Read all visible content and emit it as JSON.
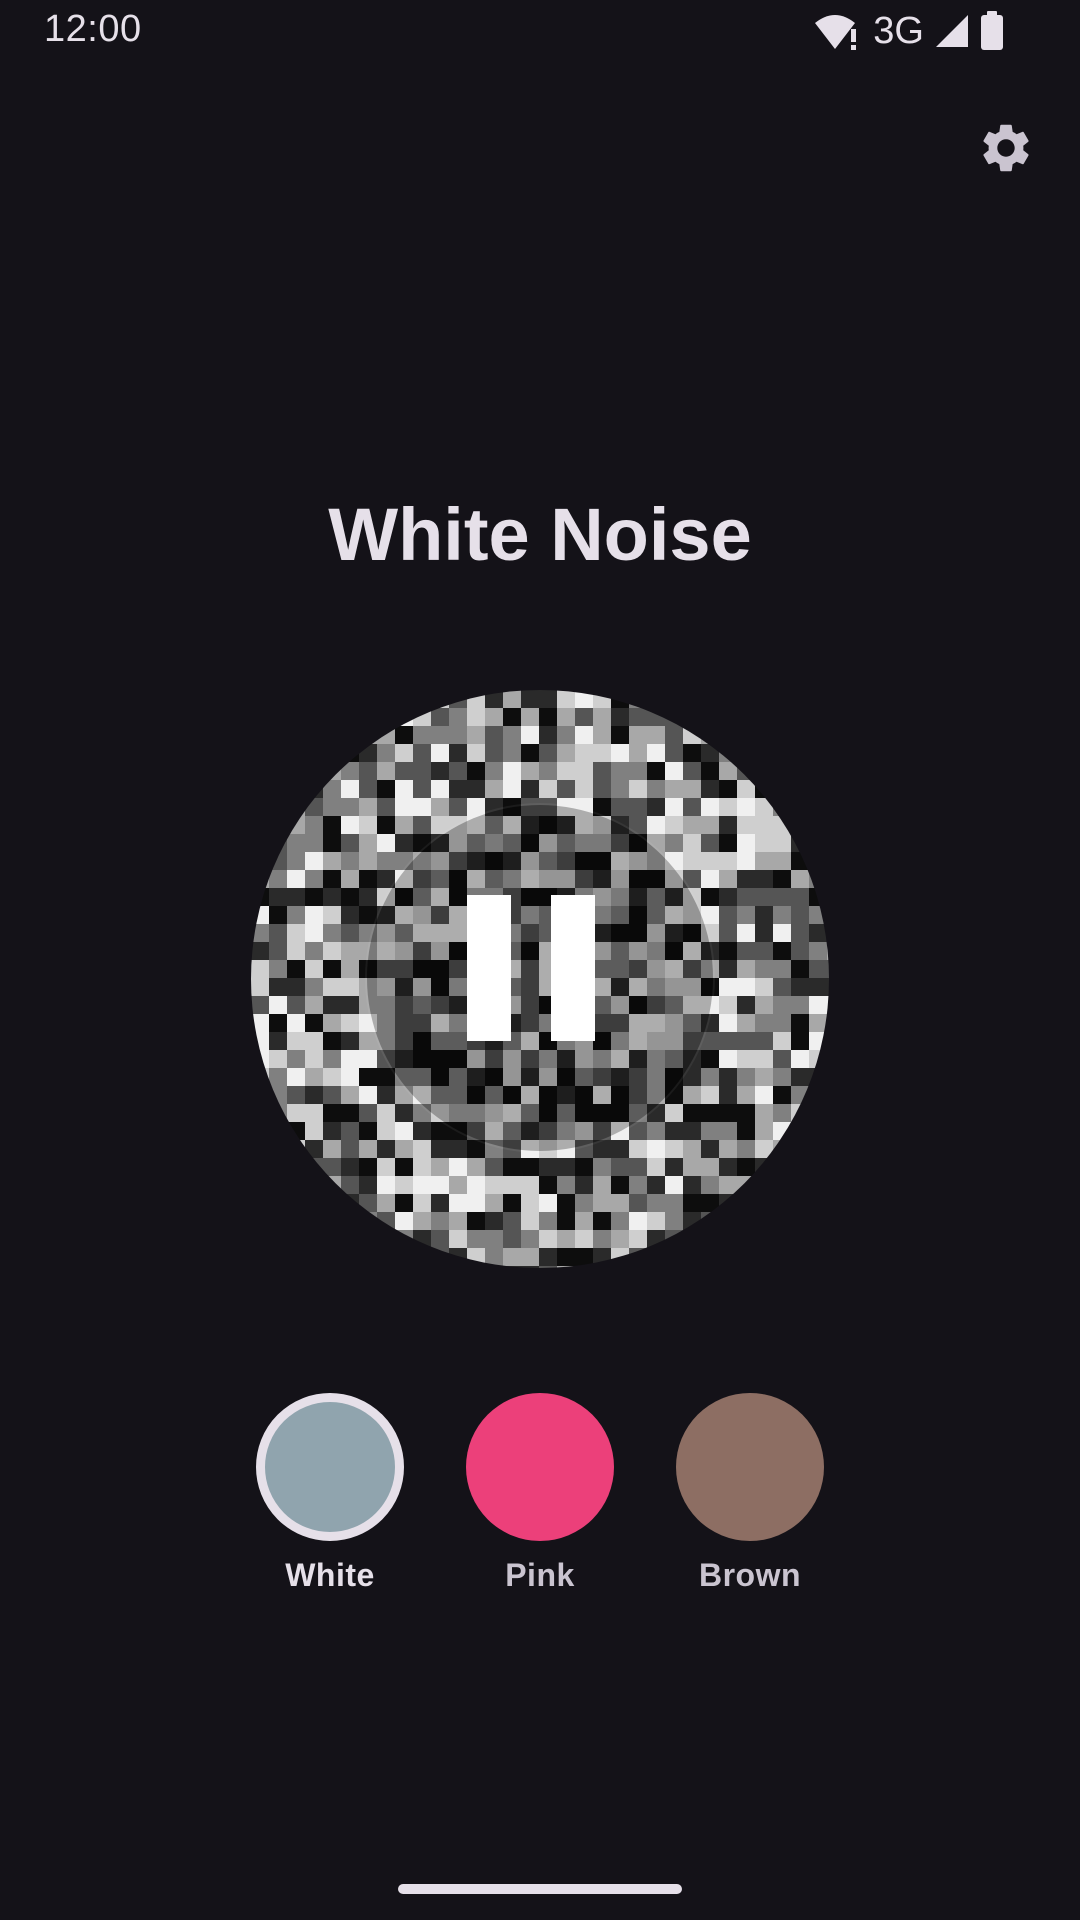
{
  "status_bar": {
    "time": "12:00",
    "network": "3G",
    "icons": [
      "wifi-alert-icon",
      "cell-signal-icon",
      "battery-icon"
    ]
  },
  "header": {
    "settings_icon": "gear-icon"
  },
  "player": {
    "title": "White Noise",
    "state": "playing",
    "control_icon": "pause-icon"
  },
  "noise_types": [
    {
      "label": "White",
      "color": "#90a4ae",
      "selected": true
    },
    {
      "label": "Pink",
      "color": "#ec407a",
      "selected": false
    },
    {
      "label": "Brown",
      "color": "#8d6e63",
      "selected": false
    }
  ],
  "colors": {
    "background": "#141218",
    "on_surface": "#e6e0e9",
    "on_surface_variant": "#cac4d0"
  }
}
